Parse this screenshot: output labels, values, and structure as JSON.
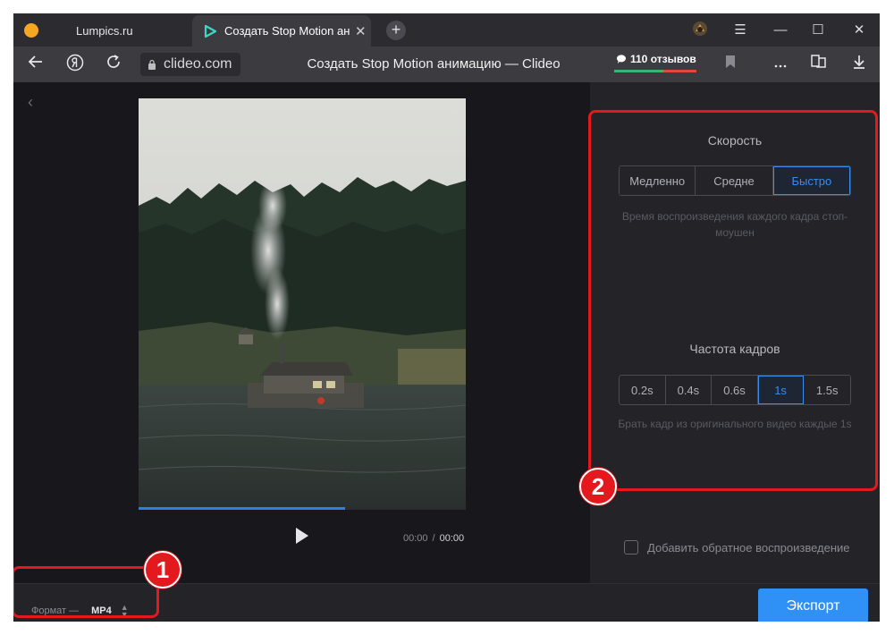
{
  "browser": {
    "tabs": [
      {
        "title": "Lumpics.ru"
      },
      {
        "title": "Создать Stop Motion ан",
        "close": "✕"
      }
    ],
    "new_tab": "+",
    "window_controls": {
      "menu": "☰",
      "minimize": "—",
      "maximize": "☐",
      "close": "✕"
    },
    "address": "clideo.com",
    "page_title": "Создать Stop Motion анимацию — Clideo",
    "reviews": "110 отзывов",
    "toolbar_icons": [
      "back-arrow-icon",
      "yandex-icon",
      "reload-icon",
      "lock-icon",
      "bookmark-icon",
      "more-icon",
      "collections-icon",
      "download-icon"
    ]
  },
  "editor": {
    "back": "‹",
    "time_current": "00:00",
    "time_separator": "/",
    "time_total": "00:00",
    "progress_fraction": 0.63,
    "speed": {
      "title": "Скорость",
      "options": [
        "Медленно",
        "Средне",
        "Быстро"
      ],
      "selected": 2,
      "hint": "Время воспроизведения каждого кадра стоп-моушен"
    },
    "frame_rate": {
      "title": "Частота кадров",
      "options": [
        "0.2s",
        "0.4s",
        "0.6s",
        "1s",
        "1.5s"
      ],
      "selected": 3,
      "hint": "Брать кадр из оригинального видео каждые 1s"
    },
    "reverse_label": "Добавить обратное воспроизведение",
    "format_label": "Формат —",
    "format_value": "MP4",
    "export_label": "Экспорт"
  },
  "annotations": {
    "marker_1": "1",
    "marker_2": "2"
  },
  "colors": {
    "accent": "#2f90f5",
    "annotation": "#e3191e"
  }
}
